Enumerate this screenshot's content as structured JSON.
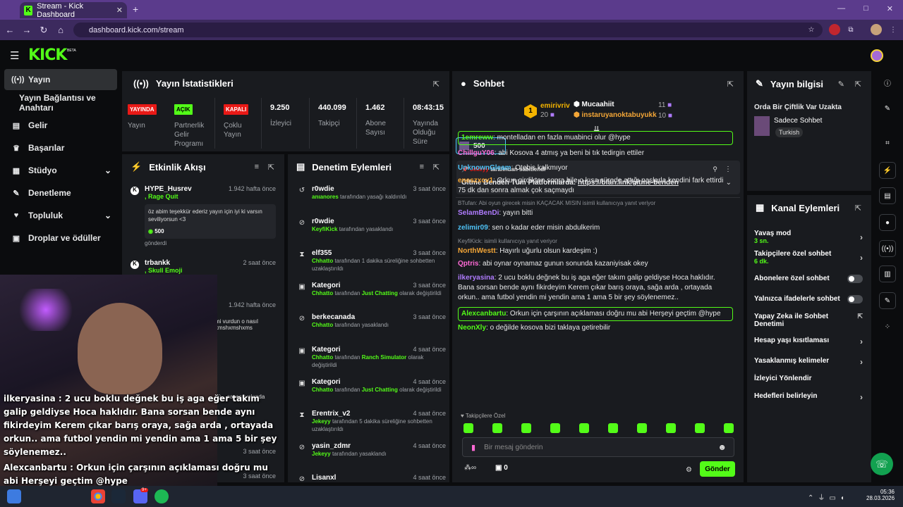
{
  "browser": {
    "tab_title": "Stream - Kick Dashboard",
    "url": "dashboard.kick.com/stream",
    "new_tab": "+",
    "close": "✕",
    "win": [
      "—",
      "□",
      "✕"
    ]
  },
  "brand": {
    "logo": "KICK",
    "beta": "BETA",
    "accent": "#53fc18"
  },
  "sidebar": {
    "items": [
      {
        "label": "Yayın",
        "icon": "broadcast-icon"
      },
      {
        "label": "Yayın Bağlantısı ve Anahtarı"
      },
      {
        "label": "Gelir",
        "icon": "revenue-icon"
      },
      {
        "label": "Başarılar",
        "icon": "trophy-icon"
      },
      {
        "label": "Stüdyo",
        "icon": "studio-icon"
      },
      {
        "label": "Denetleme",
        "icon": "wrench-icon"
      },
      {
        "label": "Topluluk",
        "icon": "community-icon"
      },
      {
        "label": "Droplar ve ödüller",
        "icon": "drops-icon"
      }
    ]
  },
  "stats": {
    "title": "Yayın İstatistikleri",
    "badges": [
      {
        "text": "YAYINDA",
        "color": "#e91916"
      },
      {
        "text": "AÇIK",
        "color": "#53fc18"
      },
      {
        "text": "KAPALI",
        "color": "#e91916"
      }
    ],
    "badge_labels": [
      "Yayın",
      "Partnerlik Gelir Programı",
      "Çoklu Yayın"
    ],
    "values": [
      {
        "v": "9.250",
        "l": "İzleyici"
      },
      {
        "v": "440.099",
        "l": "Takipçi"
      },
      {
        "v": "1.462",
        "l": "Abone Sayısı"
      },
      {
        "v": "08:43:15",
        "l": "Yayında Olduğu Süre"
      }
    ]
  },
  "feed": {
    "title": "Etkinlik Akışı",
    "items": [
      {
        "name": "HYPE_Husrev",
        "time": "1.942 hafta önce",
        "gift": ", Rage Quit",
        "message": "öz abim teşekkür ederiz yayın için iyi ki varsın seviliyorsun <3",
        "amount": "500",
        "note": "gönderdi"
      },
      {
        "name": "trbankk",
        "time": "2 saat önce",
        "gift": ", Skull Emoji"
      },
      {
        "time": "1.942 hafta önce",
        "message": "mi vurdun o nasıl xmshxmshxms"
      },
      {
        "message": "lıdı Dünya çok kötü ...savaşı yakında",
        "note": "gönderdi"
      },
      {
        "name": "EnesShock",
        "time": "3 saat önce",
        "note": "kanalı takip etti"
      },
      {
        "name": "Sue25",
        "time": "3 saat önce"
      }
    ]
  },
  "moderation": {
    "title": "Denetim Eylemleri",
    "items": [
      {
        "name": "r0wdie",
        "time": "3 saat önce",
        "actor": "anıanores",
        "desc": "tarafından yasağı kaldırıldı",
        "icon": "undo-icon"
      },
      {
        "name": "r0wdie",
        "time": "3 saat önce",
        "actor": "KeyfiKick",
        "desc": "tarafından yasaklandı",
        "icon": "ban-icon"
      },
      {
        "name": "elf355",
        "time": "3 saat önce",
        "actor": "Chhatto",
        "desc": "tarafından 1 dakika süreliğine sohbetten uzaklaştırıldı",
        "icon": "hourglass-icon"
      },
      {
        "name": "Kategori",
        "time": "3 saat önce",
        "actor": "Chhatto",
        "desc": "tarafından",
        "cat": "Just Chatting",
        "desc2": "olarak değiştirildi",
        "icon": "category-icon"
      },
      {
        "name": "berkecanada",
        "time": "3 saat önce",
        "actor": "Chhatto",
        "desc": "tarafından yasaklandı",
        "icon": "ban-icon"
      },
      {
        "name": "Kategori",
        "time": "4 saat önce",
        "actor": "Chhatto",
        "desc": "tarafından",
        "cat": "Ranch Simulator",
        "desc2": "olarak değiştirildi",
        "icon": "category-icon"
      },
      {
        "name": "Kategori",
        "time": "4 saat önce",
        "actor": "Chhatto",
        "desc": "tarafından",
        "cat": "Just Chatting",
        "desc2": "olarak değiştirildi",
        "icon": "category-icon"
      },
      {
        "name": "Erentrix_v2",
        "time": "4 saat önce",
        "actor": "Jekeyy",
        "desc": "tarafından 5 dakika süreliğine sohbetten uzaklaştırıldı",
        "icon": "hourglass-icon"
      },
      {
        "name": "yasin_zdmr",
        "time": "4 saat önce",
        "actor": "Jekeyy",
        "desc": "tarafından yasaklandı",
        "icon": "ban-icon"
      },
      {
        "name": "Lisanxl",
        "time": "4 saat önce",
        "actor": "Jekeyy",
        "desc": "tarafından yasaklandı",
        "icon": "ban-icon"
      },
      {
        "name": "Lisanxl",
        "time": "4 saat önce",
        "icon": "category-icon"
      }
    ]
  },
  "chat": {
    "title": "Sohbet",
    "top": [
      {
        "rank": "1",
        "name": "emirivriv",
        "count": "20"
      },
      {
        "name": "Mucaahiit",
        "count": "11"
      },
      {
        "name": "instaruyanoktabuyukk",
        "count": "10"
      }
    ],
    "gift_count": "500",
    "pinned": {
      "by": "Jekeyy",
      "by_suffix": "tarafından sabitlendi",
      "text": "Gitme Benden Tüm Platformlarda:",
      "link": "https://bfan.link/gitme-benden"
    },
    "messages": [
      {
        "user": "1emreww",
        "color": "#53fc18",
        "text": "montelladan en fazla muabinci olur @hype",
        "hl": true
      },
      {
        "user": "ChillguY06",
        "color": "#ff6ad5",
        "text": "abi Kosova 4 atmış ya beni bi tık tedirgin ettiler"
      },
      {
        "user": "UnknownGleam",
        "color": "#4fc3f7",
        "text": "Otebis kalkmıyor"
      },
      {
        "user": "eneszxcv1",
        "color": "#f4a637",
        "text": "Orkun girdikten sonra bile o kısa sürede attığı paslarla kendini fark ettirdi 75 dk dan sonra almak çok saçmaydı"
      },
      {
        "reply": "BTufan: Abi oyun girecek misin KAÇACAK MISIN isimli kullanıcıya yanıt veriyor",
        "user": "SelamBenDi",
        "color": "#b07cff",
        "text": "yayın bitti"
      },
      {
        "user": "zelimir09",
        "color": "#4fc3f7",
        "text": "sen o kadar eder misin abdulkerim"
      },
      {
        "reply": "KeyfiKick: isimli kullanıcıya yanıt veriyor",
        "user": "NorthWestt",
        "color": "#f4a637",
        "text": "Hayırlı uğurlu olsun kardeşim :)"
      },
      {
        "user": "Qptris",
        "color": "#ff6ad5",
        "text": "abi oynar oynamaz gunun sonunda kazaniyisak okey"
      },
      {
        "user": "ilkeryasina",
        "color": "#b07cff",
        "text": "2 ucu boklu değnek bu iş aga eğer takım galip geldiyse Hoca haklıdır. Bana sorsan bende aynı fikirdeyim Kerem çıkar barış oraya, sağa arda , ortayada orkun.. ama futbol yendin mi yendin ama 1 ama 5 bir şey söylenemez.."
      },
      {
        "user": "Alexcanbartu",
        "color": "#53fc18",
        "text": "Orkun için çarşının açıklaması doğru mu abi Herşeyi geçtim @hype",
        "hl": true
      },
      {
        "user": "NeonXly",
        "color": "#53fc18",
        "text": "o değilde kosova bizi taklaya getirebilir"
      }
    ],
    "followers_label": "Takipçilere Özel",
    "input_placeholder": "Bir mesaj gönderin",
    "send": "Gönder",
    "points": "0"
  },
  "info": {
    "title": "Yayın bilgisi",
    "stream_title": "Orda Bir Çiftlik Var Uzakta",
    "category": "Sadece Sohbet",
    "tag": "Turkish"
  },
  "actions": {
    "title": "Kanal Eylemleri",
    "items": [
      {
        "label": "Yavaş mod",
        "sub": "3 sn.",
        "type": "arrow"
      },
      {
        "label": "Takipçilere özel sohbet",
        "sub": "6 dk.",
        "type": "arrow"
      },
      {
        "label": "Abonelere özel sohbet",
        "type": "toggle"
      },
      {
        "label": "Yalnızca ifadelerle sohbet",
        "type": "toggle"
      },
      {
        "label": "Yapay Zeka ile Sohbet Denetimi",
        "type": "external"
      },
      {
        "label": "Hesap yaşı kısıtlaması",
        "type": "arrow"
      },
      {
        "label": "Yasaklanmış kelimeler",
        "type": "arrow"
      },
      {
        "label": "İzleyici Yönlendir",
        "type": "none"
      },
      {
        "label": "Hedefleri belirleyin",
        "type": "arrow"
      }
    ]
  },
  "overlay": {
    "lines": [
      "ilkeryasina : 2 ucu boklu değnek bu iş aga eğer takım",
      "galip geldiyse Hoca haklıdır. Bana sorsan bende aynı",
      "fikirdeyim Kerem çıkar barış oraya, sağa arda , ortayada",
      "orkun.. ama futbol yendin mi yendin ama 1 ama 5 bir şey",
      "söylenemez..",
      "Alexcanbartu : Orkun için çarşının açıklaması doğru mu",
      "abi Herşeyi geçtim @hype",
      "izi taklaya getirebilir"
    ]
  },
  "taskbar": {
    "time": "05:36",
    "date": "28.03.2026",
    "notif": "9+"
  }
}
